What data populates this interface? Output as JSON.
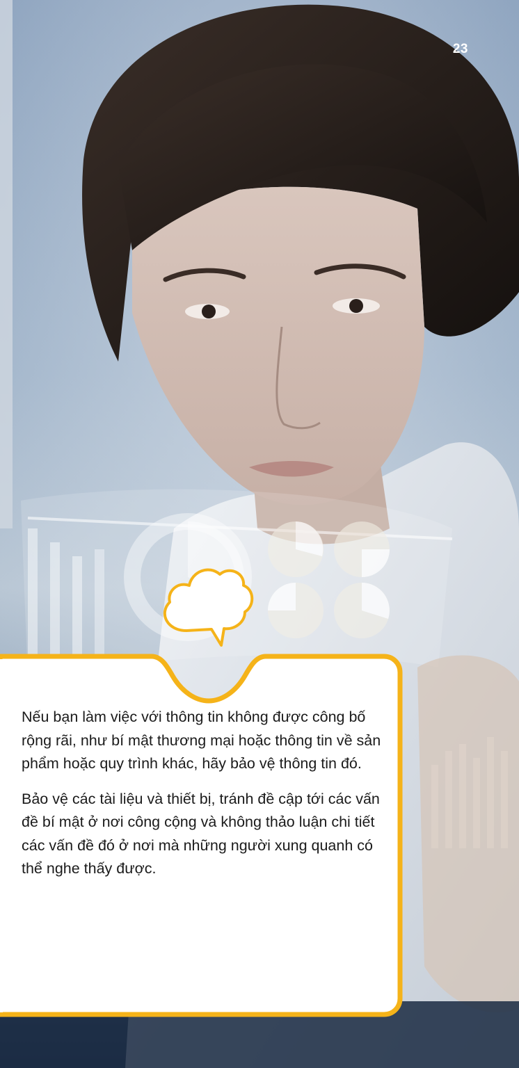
{
  "page": {
    "number": "23"
  },
  "callout": {
    "paragraphs": [
      "Nếu bạn làm việc với thông tin không được công bố rộng rãi, như bí mật thương mại hoặc thông tin về sản phẩm hoặc quy trình khác, hãy bảo vệ thông tin đó.",
      "Bảo vệ các tài liệu và thiết bị, tránh đề cập tới các vấn đề bí mật ở nơi công cộng và không thảo luận chi tiết các vấn đề đó ở nơi mà những người xung quanh có thể nghe thấy được."
    ],
    "icon": "speech-cloud-icon"
  },
  "colors": {
    "accent": "#f5b319",
    "callout_background": "#ffffff",
    "text": "#1b1b1b",
    "page_number": "#ffffff"
  },
  "photo": {
    "subject": "woman-scientist-with-holographic-charts"
  }
}
